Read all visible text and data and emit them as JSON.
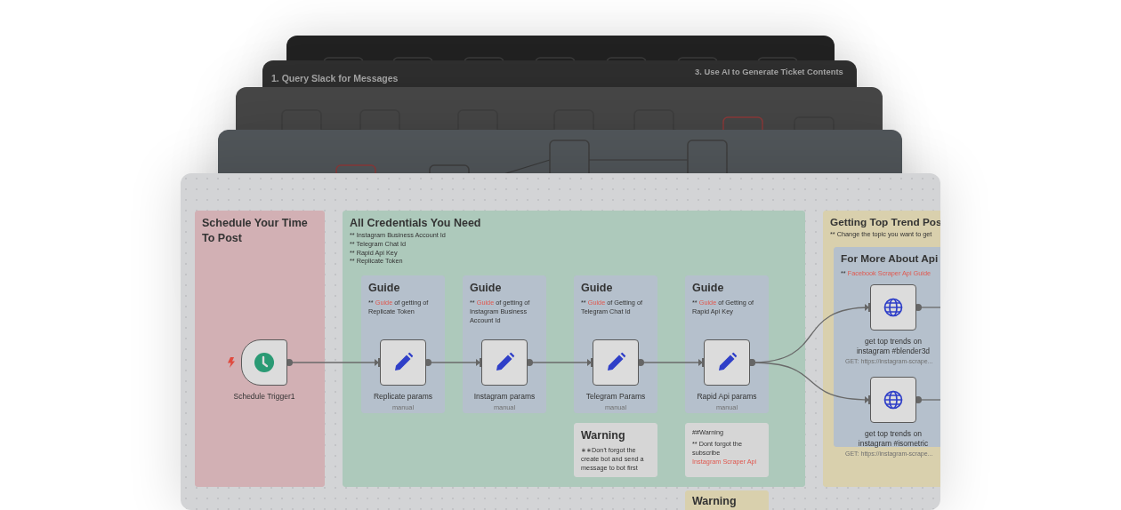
{
  "background_workflows": {
    "notes": [
      {
        "title": "1. Query Slack for Messages"
      },
      {
        "title": "3. Use AI to Generate Ticket Contents"
      }
    ]
  },
  "workflow": {
    "notes": [
      {
        "kind": "sticky",
        "color": "#d2b0b4",
        "title": "Schedule Your Time To Post"
      },
      {
        "kind": "sticky",
        "color": "#adc9bb",
        "title": "All Credentials You Need",
        "lines": [
          "** Instagram Business Account Id",
          "** Telegram Chat Id",
          "** Rapid Api Key",
          "** Replicate Token"
        ]
      },
      {
        "kind": "sticky",
        "color": "#d9d0ad",
        "title": "Getting Top Trend Pos",
        "lines": [
          "** Change the topic you want to get"
        ]
      },
      {
        "kind": "sticky",
        "color": "#b5c0cc",
        "title": "Guide",
        "body": [
          {
            "kind": "text",
            "text": "** "
          },
          {
            "kind": "link",
            "text": "Guide"
          },
          {
            "kind": "text",
            "text": " of getting of Replicate Token"
          }
        ]
      },
      {
        "kind": "sticky",
        "color": "#b5c0cc",
        "title": "Guide",
        "body": [
          {
            "kind": "text",
            "text": "** "
          },
          {
            "kind": "link",
            "text": "Guide"
          },
          {
            "kind": "text",
            "text": " of getting of Instagram Business Account Id"
          }
        ]
      },
      {
        "kind": "sticky",
        "color": "#b5c0cc",
        "title": "Guide",
        "body": [
          {
            "kind": "text",
            "text": "** "
          },
          {
            "kind": "link",
            "text": "Guide"
          },
          {
            "kind": "text",
            "text": " of Getting of Telegram Chat Id"
          }
        ]
      },
      {
        "kind": "sticky",
        "color": "#b5c0cc",
        "title": "Guide",
        "body": [
          {
            "kind": "text",
            "text": "** "
          },
          {
            "kind": "link",
            "text": "Guide"
          },
          {
            "kind": "text",
            "text": " of Getting of Rapid Api Key"
          }
        ]
      },
      {
        "kind": "sticky",
        "color": "#d6d6d6",
        "title": "Warning",
        "body": [
          {
            "kind": "text",
            "text": "∗∗Don't forgot the create bot and send a message to bot first"
          }
        ]
      },
      {
        "kind": "sticky",
        "color": "#d6d6d6",
        "lines": [
          "##Warning"
        ],
        "body": [
          {
            "kind": "text",
            "text": "** Dont forgot the subscribe "
          },
          {
            "kind": "link",
            "text": "Instagram Scraper Api"
          }
        ]
      },
      {
        "kind": "sticky",
        "color": "#b5c0cc",
        "title": "For More About Api",
        "body": [
          {
            "kind": "text",
            "text": "** "
          },
          {
            "kind": "link",
            "text": "Facebook Scraper Api Guide"
          }
        ]
      },
      {
        "kind": "sticky",
        "color": "#d9d0ad",
        "title": "Warning"
      }
    ],
    "nodes": [
      {
        "kind": "trigger",
        "name": "Schedule Trigger1"
      },
      {
        "kind": "set",
        "name": "Replicate params",
        "subtitle": "manual"
      },
      {
        "kind": "set",
        "name": "Instagram params",
        "subtitle": "manual"
      },
      {
        "kind": "set",
        "name": "Telegram Params",
        "subtitle": "manual"
      },
      {
        "kind": "set",
        "name": "Rapid Api params",
        "subtitle": "manual"
      },
      {
        "kind": "http",
        "name": "get top trends on instagram #blender3d",
        "subtitle": "GET: https://instagram-scrape..."
      },
      {
        "kind": "http",
        "name": "get top trends on instagram #isometric",
        "subtitle": "GET: https://instagram-scrape..."
      }
    ]
  }
}
